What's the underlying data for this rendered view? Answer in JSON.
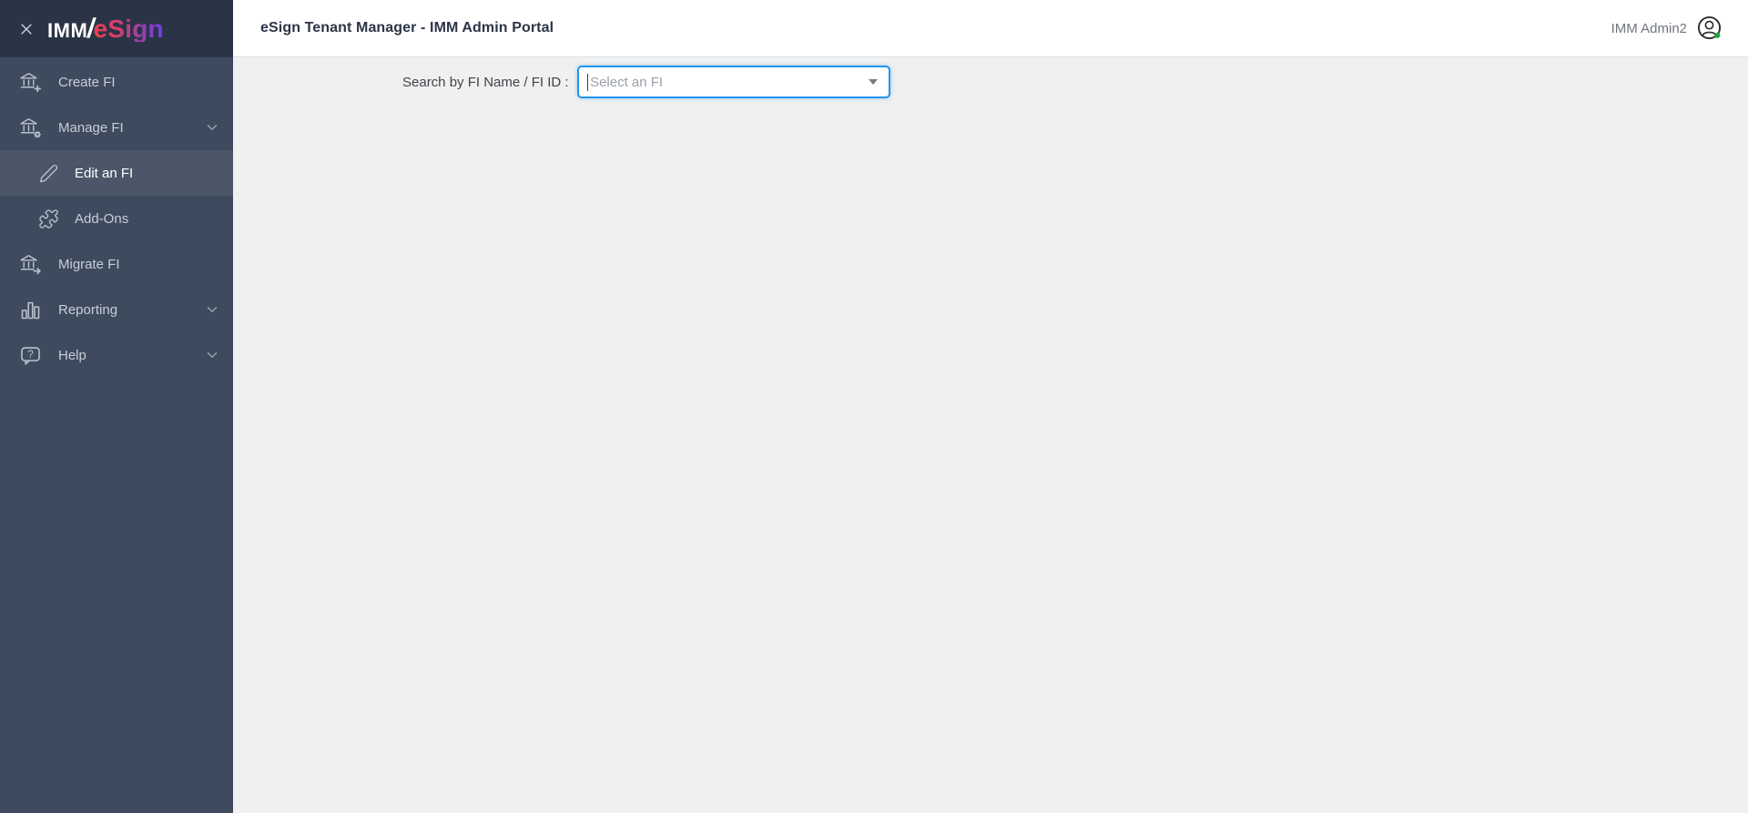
{
  "sidebar": {
    "logo": {
      "imm": "IMM",
      "slash": "/",
      "esign": "eSign"
    },
    "items": [
      {
        "label": "Create FI",
        "icon": "bank-plus",
        "active": false,
        "sub": false,
        "expandable": false
      },
      {
        "label": "Manage FI",
        "icon": "bank-gear",
        "active": false,
        "sub": false,
        "expandable": true
      },
      {
        "label": "Edit an FI",
        "icon": "pencil",
        "active": true,
        "sub": true,
        "expandable": false
      },
      {
        "label": "Add-Ons",
        "icon": "puzzle",
        "active": false,
        "sub": true,
        "expandable": false
      },
      {
        "label": "Migrate FI",
        "icon": "bank-arrow",
        "active": false,
        "sub": false,
        "expandable": false
      },
      {
        "label": "Reporting",
        "icon": "bar-chart",
        "active": false,
        "sub": false,
        "expandable": true
      },
      {
        "label": "Help",
        "icon": "help-bubble",
        "active": false,
        "sub": false,
        "expandable": true
      }
    ]
  },
  "header": {
    "title": "eSign Tenant Manager - IMM Admin Portal",
    "user": {
      "name": "IMM Admin2",
      "status": "online"
    }
  },
  "main": {
    "search_label": "Search by FI Name / FI ID :",
    "select_placeholder": "Select an FI"
  },
  "colors": {
    "sidebar_bg": "#3e4b5f",
    "sidebar_header_bg": "#2b3447",
    "active_item_bg": "#4b5769",
    "select_focus_border": "#2196f3",
    "status_green": "#23a33a",
    "logo_gradient_start": "#f23e4e",
    "logo_gradient_end": "#6b40e6",
    "main_bg": "#f0f0f0"
  }
}
